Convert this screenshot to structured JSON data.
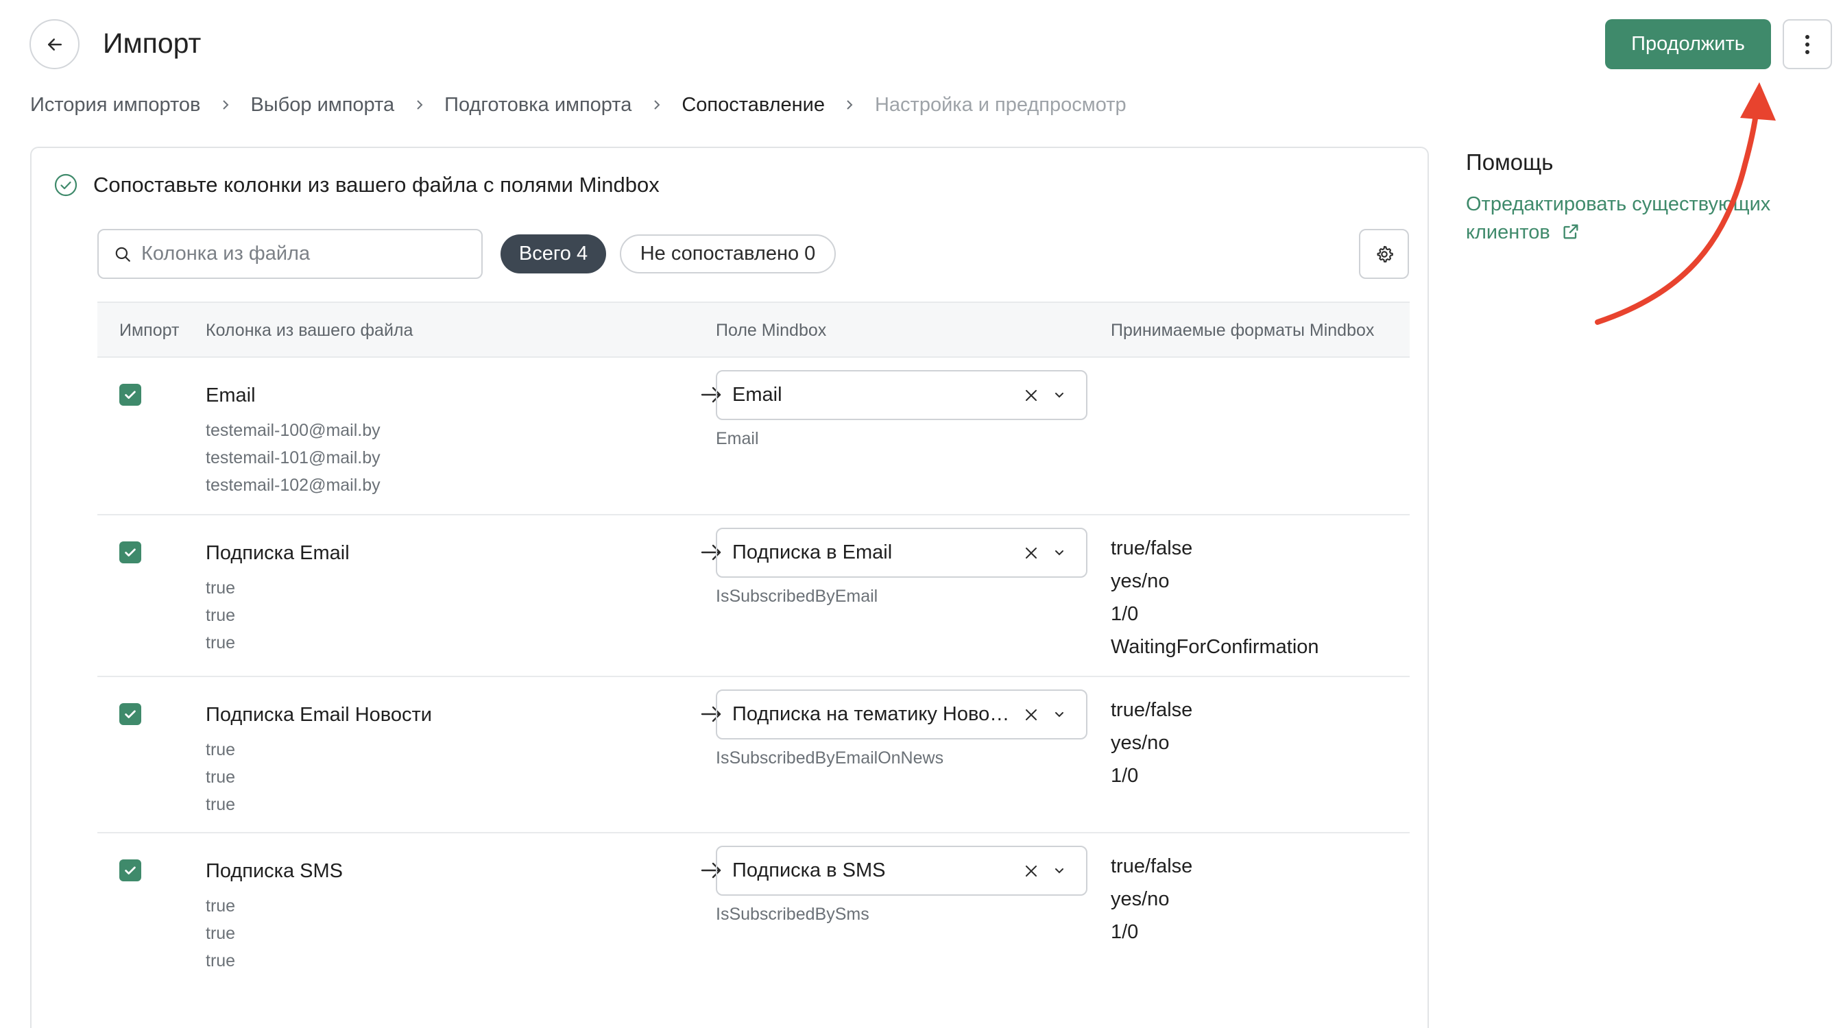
{
  "header": {
    "title": "Импорт",
    "continue_label": "Продолжить"
  },
  "breadcrumbs": [
    {
      "label": "История импортов",
      "state": "link"
    },
    {
      "label": "Выбор импорта",
      "state": "link"
    },
    {
      "label": "Подготовка импорта",
      "state": "link"
    },
    {
      "label": "Сопоставление",
      "state": "current"
    },
    {
      "label": "Настройка и предпросмотр",
      "state": "disabled"
    }
  ],
  "card": {
    "title": "Сопоставьте колонки из вашего файла с полями Mindbox",
    "search_placeholder": "Колонка из файла",
    "chips": {
      "all": "Всего 4",
      "unmatched": "Не сопоставлено 0"
    },
    "columns": {
      "import": "Импорт",
      "file_column": "Колонка из вашего файла",
      "mindbox_field": "Поле Mindbox",
      "formats": "Принимаемые форматы Mindbox"
    },
    "rows": [
      {
        "checked": true,
        "name": "Email",
        "samples": [
          "testemail-100@mail.by",
          "testemail-101@mail.by",
          "testemail-102@mail.by"
        ],
        "field": "Email",
        "field_key": "Email",
        "formats": []
      },
      {
        "checked": true,
        "name": "Подписка Email",
        "samples": [
          "true",
          "true",
          "true"
        ],
        "field": "Подписка в Email",
        "field_key": "IsSubscribedByEmail",
        "formats": [
          "true/false",
          "yes/no",
          "1/0",
          "WaitingForConfirmation"
        ]
      },
      {
        "checked": true,
        "name": "Подписка Email Новости",
        "samples": [
          "true",
          "true",
          "true"
        ],
        "field": "Подписка на тематику Новости",
        "field_key": "IsSubscribedByEmailOnNews",
        "formats": [
          "true/false",
          "yes/no",
          "1/0"
        ]
      },
      {
        "checked": true,
        "name": "Подписка SMS",
        "samples": [
          "true",
          "true",
          "true"
        ],
        "field": "Подписка в SMS",
        "field_key": "IsSubscribedBySms",
        "formats": [
          "true/false",
          "yes/no",
          "1/0"
        ]
      }
    ]
  },
  "help": {
    "title": "Помощь",
    "link_label": "Отредактировать существующих клиентов"
  },
  "colors": {
    "accent": "#3f8a6b",
    "chip_active": "#3d4752",
    "annotation": "#e8432e"
  },
  "icons": {
    "back": "arrow-left-icon",
    "more": "more-vertical-icon",
    "breadcrumb_separator": "chevron-right-icon",
    "card_status": "check-circle-icon",
    "search": "search-icon",
    "settings": "gear-icon",
    "checkbox": "checkmark-icon",
    "mapping": "arrow-right-icon",
    "clear": "close-icon",
    "dropdown": "chevron-down-icon",
    "external": "external-link-icon"
  }
}
